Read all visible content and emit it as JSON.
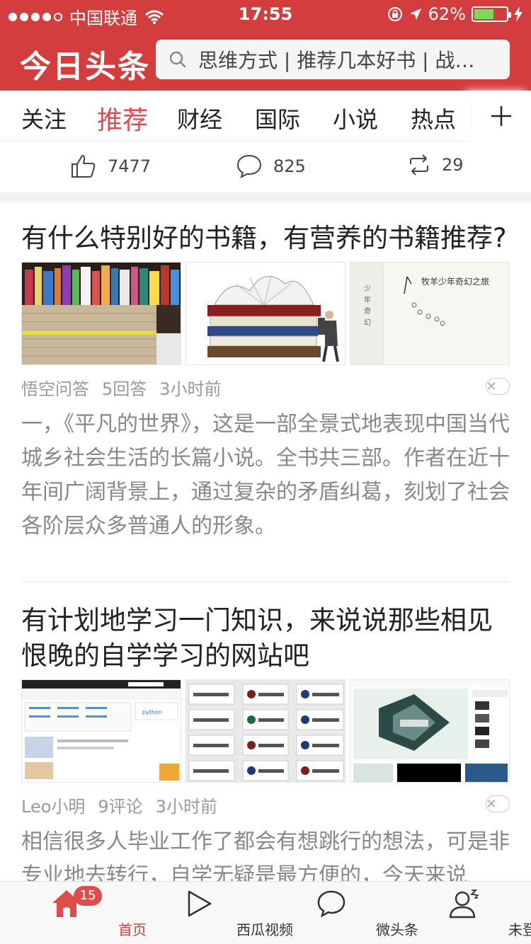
{
  "status_bar": {
    "carrier": "中国联通",
    "time": "17:55",
    "battery": "62%",
    "battery_level": 0.62
  },
  "header": {
    "logo": "今日头条",
    "search_placeholder": "思维方式 | 推荐几本好书 | 战…"
  },
  "tabs": [
    {
      "label": "关注"
    },
    {
      "label": "推荐",
      "active": true
    },
    {
      "label": "财经"
    },
    {
      "label": "国际"
    },
    {
      "label": "小说"
    },
    {
      "label": "热点"
    }
  ],
  "reactions": {
    "likes": "7477",
    "comments": "825",
    "shares": "29"
  },
  "articles": [
    {
      "title": "有什么特别好的书籍，有营养的书籍推荐?",
      "thumb3_caption": "牧羊少年奇幻之旅",
      "source": "悟空问答",
      "count": "5回答",
      "time": "3小时前",
      "summary": "一，《平凡的世界》，这是一部全景式地表现中国当代城乡社会生活的长篇小说。全书共三部。作者在近十年间广阔背景上，通过复杂的矛盾纠葛，刻划了社会各阶层众多普通人的形象。"
    },
    {
      "title": "有计划地学习一门知识，来说说那些相见恨晚的自学学习的网站吧",
      "source": "Leo小明",
      "count": "9评论",
      "time": "3小时前",
      "summary": "相信很多人毕业工作了都会有想跳行的想法，可是非专业地去转行，自学无疑是最方便的，今天来说"
    }
  ],
  "bottom_nav": [
    {
      "label": "首页",
      "badge": "15",
      "active": true
    },
    {
      "label": "西瓜视频"
    },
    {
      "label": "微头条"
    },
    {
      "label": "未登录"
    }
  ],
  "colors": {
    "brand_red": "#d43d3d",
    "active_tab": "#e04c4c"
  }
}
